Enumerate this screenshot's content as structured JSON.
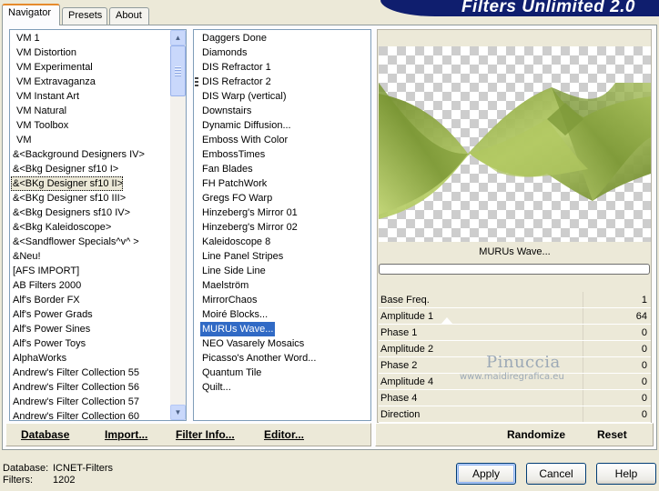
{
  "app_title": "Filters Unlimited 2.0",
  "tabs": [
    {
      "label": "Navigator",
      "active": true
    },
    {
      "label": "Presets",
      "active": false
    },
    {
      "label": "About",
      "active": false
    }
  ],
  "categories": {
    "items": [
      "VM 1",
      "VM Distortion",
      "VM Experimental",
      "VM Extravaganza",
      "VM Instant Art",
      "VM Natural",
      "VM Toolbox",
      "VM",
      "&<Background Designers IV>",
      "&<Bkg Designer sf10 I>",
      "&<BKg Designer sf10 II>",
      "&<BKg Designer sf10 III>",
      "&<Bkg Designers sf10 IV>",
      "&<Bkg Kaleidoscope>",
      "&<Sandflower Specials^v^ >",
      "&Neu!",
      "[AFS IMPORT]",
      "AB Filters 2000",
      "Alf's Border FX",
      "Alf's Power Grads",
      "Alf's Power Sines",
      "Alf's Power Toys",
      "AlphaWorks",
      "Andrew's Filter Collection 55",
      "Andrew's Filter Collection 56",
      "Andrew's Filter Collection 57",
      "Andrew's Filter Collection 60"
    ],
    "selected": "&<BKg Designer sf10 II>"
  },
  "filters": {
    "items": [
      "Daggers Done",
      "Diamonds",
      "DIS Refractor 1",
      "DIS Refractor 2",
      "DIS Warp (vertical)",
      "Downstairs",
      "Dynamic Diffusion...",
      "Emboss With Color",
      "EmbossTimes",
      "Fan Blades",
      "FH PatchWork",
      "Gregs FO Warp",
      "Hinzeberg's Mirror 01",
      "Hinzeberg's Mirror 02",
      "Kaleidoscope 8",
      "Line Panel Stripes",
      "Line Side Line",
      "Maelström",
      "MirrorChaos",
      "Moiré Blocks...",
      "MURUs Wave...",
      "NEO Vasarely Mosaics",
      "Picasso's Another Word...",
      "Quantum Tile",
      "Quilt..."
    ],
    "selected": "MURUs Wave..."
  },
  "preview": {
    "filter_name": "MURUs Wave...",
    "watermark_name": "Pinuccia",
    "watermark_url": "www.maidiregrafica.eu"
  },
  "params": [
    {
      "name": "Base Freq.",
      "value": "1"
    },
    {
      "name": "Amplitude 1",
      "value": "64"
    },
    {
      "name": "Phase 1",
      "value": "0"
    },
    {
      "name": "Amplitude 2",
      "value": "0"
    },
    {
      "name": "Phase 2",
      "value": "0"
    },
    {
      "name": "Amplitude 4",
      "value": "0"
    },
    {
      "name": "Phase 4",
      "value": "0"
    },
    {
      "name": "Direction",
      "value": "0"
    }
  ],
  "left_bar": {
    "database": "Database",
    "import": "Import...",
    "filter_info": "Filter Info...",
    "editor": "Editor..."
  },
  "right_bar": {
    "randomize": "Randomize",
    "reset": "Reset"
  },
  "status": {
    "database_label": "Database:",
    "database_value": "ICNET-Filters",
    "filters_label": "Filters:",
    "filters_value": "1202"
  },
  "buttons": {
    "apply": "Apply",
    "cancel": "Cancel",
    "help": "Help"
  },
  "colors": {
    "selection": "#316AC5",
    "banner": "#0F1E6E",
    "wave": "#9DB34F"
  }
}
